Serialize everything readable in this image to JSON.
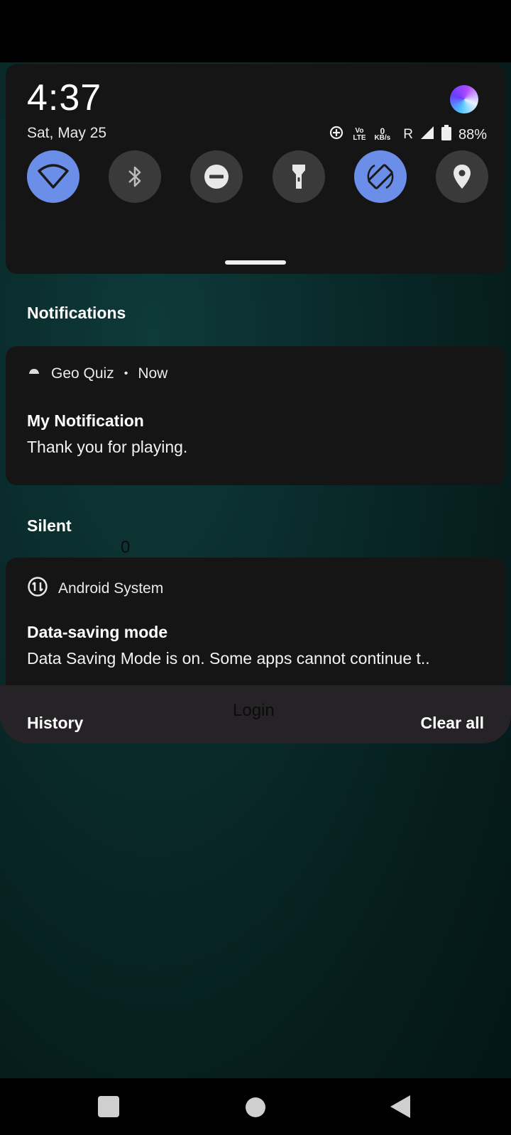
{
  "quick_settings": {
    "time": "4:37",
    "date": "Sat, May 25",
    "status": {
      "volte_label": "Vo LTE",
      "speed_value": "0",
      "speed_unit": "KB/s",
      "roaming": "R",
      "battery": "88%"
    },
    "tiles": [
      {
        "name": "wifi",
        "state": "on"
      },
      {
        "name": "bluetooth",
        "state": "off"
      },
      {
        "name": "do-not-disturb",
        "state": "off"
      },
      {
        "name": "flashlight",
        "state": "off"
      },
      {
        "name": "auto-rotate",
        "state": "on"
      },
      {
        "name": "location",
        "state": "off"
      }
    ]
  },
  "sections": {
    "notifications": "Notifications",
    "silent": "Silent"
  },
  "notifications": [
    {
      "app": "Geo Quiz",
      "separator": "•",
      "time": "Now",
      "title": "My Notification",
      "text": "Thank you for playing."
    },
    {
      "app": "Android System",
      "title": "Data-saving mode",
      "text": "Data Saving Mode is on. Some apps cannot continue t.."
    }
  ],
  "background": {
    "digit": "0",
    "login": "Login"
  },
  "footer": {
    "history": "History",
    "clear_all": "Clear all"
  },
  "colors": {
    "tile_on": "#6b8ee8",
    "tile_off": "#3a3a3a",
    "panel": "#151515"
  }
}
